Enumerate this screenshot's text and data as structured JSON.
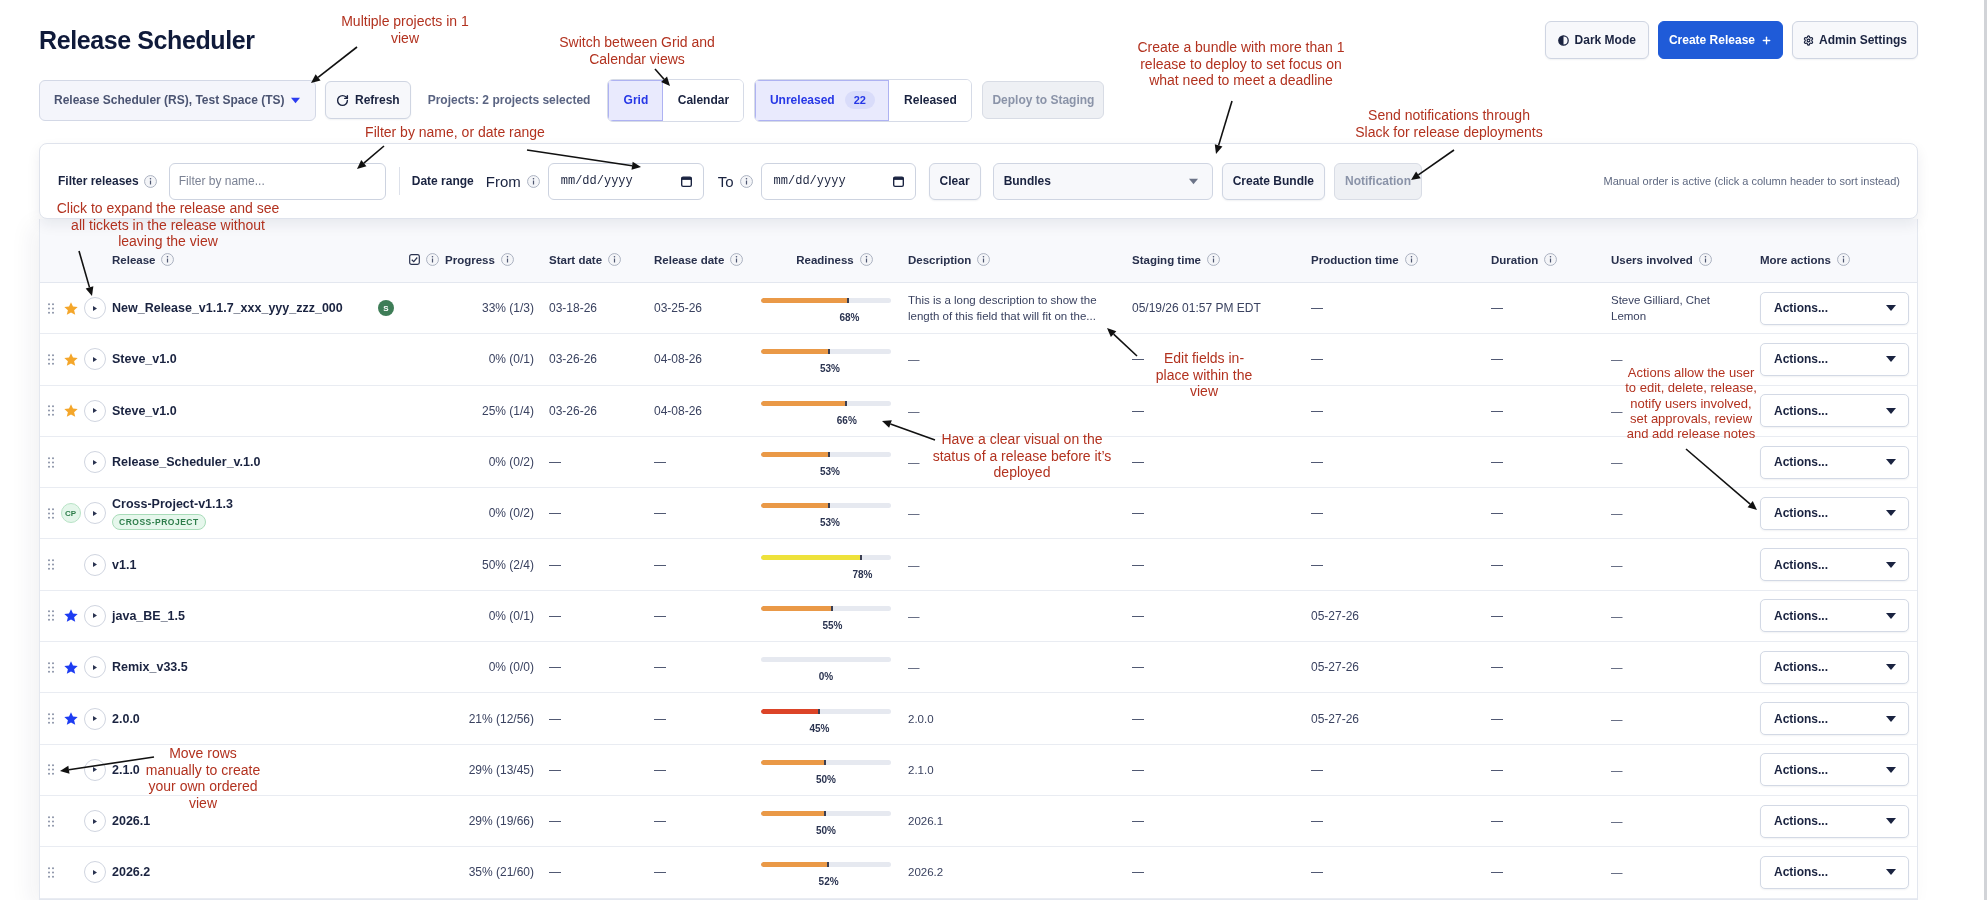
{
  "header": {
    "title": "Release Scheduler",
    "buttons": [
      {
        "kind": "theme",
        "label": "Dark Mode"
      },
      {
        "kind": "create",
        "label": "Create Release"
      },
      {
        "kind": "settings",
        "label": "Admin Settings"
      }
    ]
  },
  "toolbar": {
    "project_select": {
      "value": "Release Scheduler (RS), Test Space (TS)"
    },
    "refresh": {
      "label": "Refresh"
    },
    "projects_summary": "Projects: 2 projects selected",
    "view_modes": [
      {
        "label": "Grid",
        "selected": true
      },
      {
        "label": "Calendar",
        "selected": false
      }
    ],
    "status_tabs": [
      {
        "label": "Unreleased",
        "count": "22",
        "selected": true
      },
      {
        "label": "Released",
        "selected": false
      }
    ],
    "deploy": {
      "label": "Deploy to Staging",
      "disabled": true
    }
  },
  "filters": {
    "name_filter": {
      "label": "Filter releases",
      "placeholder": "Filter by name..."
    },
    "date_range": {
      "label": "Date range",
      "from": {
        "label": "From",
        "placeholder": "mm/dd/yyyy"
      },
      "to": {
        "label": "To",
        "placeholder": "mm/dd/yyyy"
      }
    },
    "clear": {
      "label": "Clear",
      "disabled": false
    },
    "bundle_select": {
      "value": "Bundles"
    },
    "create_bundle": {
      "label": "Create Bundle",
      "disabled": false
    },
    "notification": {
      "label": "Notification",
      "disabled": true
    },
    "sort_note": "Manual order is active (click a column header to sort instead)"
  },
  "table": {
    "columns": [
      {
        "label": "Release"
      },
      {
        "label": "Progress",
        "toggle": {
          "checked": true
        }
      },
      {
        "label": "Start date"
      },
      {
        "label": "Release date"
      },
      {
        "label": "Readiness"
      },
      {
        "label": "Description"
      },
      {
        "label": "Staging time"
      },
      {
        "label": "Production time"
      },
      {
        "label": "Duration"
      },
      {
        "label": "Users involved"
      },
      {
        "label": "More actions"
      }
    ],
    "rows": [
      {
        "marker": {
          "kind": "star",
          "color": "#f4a62a"
        },
        "name": "New_Release_v1.1.7_xxx_yyy_zzz_000",
        "avatar": "S",
        "progress": "33% (1/3)",
        "start_date": "03-18-26",
        "release_date": "03-25-26",
        "readiness": {
          "level": 0.68,
          "label": "68%"
        },
        "description": "This is a long description to show the length of this field that will fit on the...",
        "staging_time": "05/19/26 01:57 PM EDT",
        "production_time": "—",
        "duration": "—",
        "users": "Steve Gilliard, Chet Lemon",
        "action": "Actions..."
      },
      {
        "marker": {
          "kind": "star",
          "color": "#f4a62a"
        },
        "name": "Steve_v1.0",
        "progress": "0% (0/1)",
        "start_date": "03-26-26",
        "release_date": "04-08-26",
        "readiness": {
          "level": 0.53,
          "label": "53%"
        },
        "description": "—",
        "staging_time": "—",
        "production_time": "—",
        "duration": "—",
        "users": "—",
        "action": "Actions..."
      },
      {
        "marker": {
          "kind": "star",
          "color": "#f4a62a"
        },
        "name": "Steve_v1.0",
        "progress": "25% (1/4)",
        "start_date": "03-26-26",
        "release_date": "04-08-26",
        "readiness": {
          "level": 0.66,
          "label": "66%"
        },
        "description": "—",
        "staging_time": "—",
        "production_time": "—",
        "duration": "—",
        "users": "—",
        "action": "Actions..."
      },
      {
        "name": "Release_Scheduler_v.1.0",
        "progress": "0% (0/2)",
        "start_date": "—",
        "release_date": "—",
        "readiness": {
          "level": 0.53,
          "label": "53%"
        },
        "description": "—",
        "staging_time": "—",
        "production_time": "—",
        "duration": "—",
        "users": "—",
        "action": "Actions..."
      },
      {
        "marker": {
          "kind": "badge",
          "label": "CP"
        },
        "name": "Cross-Project-v1.1.3",
        "tag": "CROSS-PROJECT",
        "progress": "0% (0/2)",
        "start_date": "—",
        "release_date": "—",
        "readiness": {
          "level": 0.53,
          "label": "53%"
        },
        "description": "—",
        "staging_time": "—",
        "production_time": "—",
        "duration": "—",
        "users": "—",
        "action": "Actions..."
      },
      {
        "name": "v1.1",
        "progress": "50% (2/4)",
        "start_date": "—",
        "release_date": "—",
        "readiness": {
          "level": 0.78,
          "label": "78%"
        },
        "description": "—",
        "staging_time": "—",
        "production_time": "—",
        "duration": "—",
        "users": "—",
        "action": "Actions..."
      },
      {
        "marker": {
          "kind": "star",
          "color": "#1d3cf2"
        },
        "name": "java_BE_1.5",
        "progress": "0% (0/1)",
        "start_date": "—",
        "release_date": "—",
        "readiness": {
          "level": 0.55,
          "label": "55%"
        },
        "description": "—",
        "staging_time": "—",
        "production_time": "05-27-26",
        "duration": "—",
        "users": "—",
        "action": "Actions..."
      },
      {
        "marker": {
          "kind": "star",
          "color": "#1d3cf2"
        },
        "name": "Remix_v33.5",
        "progress": "0% (0/0)",
        "start_date": "—",
        "release_date": "—",
        "readiness": {
          "level": 0,
          "label": "0%"
        },
        "description": "—",
        "staging_time": "—",
        "production_time": "05-27-26",
        "duration": "—",
        "users": "—",
        "action": "Actions..."
      },
      {
        "marker": {
          "kind": "star",
          "color": "#1d3cf2"
        },
        "name": "2.0.0",
        "progress": "21% (12/56)",
        "start_date": "—",
        "release_date": "—",
        "readiness": {
          "level": 0.45,
          "label": "45%"
        },
        "description": "2.0.0",
        "staging_time": "—",
        "production_time": "05-27-26",
        "duration": "—",
        "users": "—",
        "action": "Actions..."
      },
      {
        "name": "2.1.0",
        "progress": "29% (13/45)",
        "start_date": "—",
        "release_date": "—",
        "readiness": {
          "level": 0.5,
          "label": "50%"
        },
        "description": "2.1.0",
        "staging_time": "—",
        "production_time": "—",
        "duration": "—",
        "users": "—",
        "action": "Actions..."
      },
      {
        "name": "2026.1",
        "progress": "29% (19/66)",
        "start_date": "—",
        "release_date": "—",
        "readiness": {
          "level": 0.5,
          "label": "50%"
        },
        "description": "2026.1",
        "staging_time": "—",
        "production_time": "—",
        "duration": "—",
        "users": "—",
        "action": "Actions..."
      },
      {
        "name": "2026.2",
        "progress": "35% (21/60)",
        "start_date": "—",
        "release_date": "—",
        "readiness": {
          "level": 0.52,
          "label": "52%"
        },
        "description": "2026.2",
        "staging_time": "—",
        "production_time": "—",
        "duration": "—",
        "users": "—",
        "action": "Actions..."
      }
    ]
  },
  "annotations": [
    {
      "lines": [
        "Multiple projects in 1",
        "view"
      ]
    },
    {
      "lines": [
        "Switch between Grid and",
        "Calendar views"
      ]
    },
    {
      "lines": [
        "Create a bundle with more than 1",
        "release to deploy to set focus on",
        "what need to meet a deadline"
      ]
    },
    {
      "lines": [
        "Filter by name, or date range"
      ]
    },
    {
      "lines": [
        "Send notifications through",
        "Slack for release deployments"
      ]
    },
    {
      "lines": [
        "Click to expand the release and see",
        "all tickets in the release without",
        "leaving the view"
      ]
    },
    {
      "lines": [
        "Edit fields in-",
        "place within the",
        "view"
      ]
    },
    {
      "lines": [
        "Actions allow the user",
        "to edit, delete, release,",
        "notify users involved,",
        "set approvals, review",
        "and add release notes"
      ]
    },
    {
      "lines": [
        "Have a clear visual on the",
        "status of a release before it’s",
        "deployed"
      ]
    },
    {
      "lines": [
        "Move rows",
        "manually to create",
        "your own ordered",
        "view"
      ]
    }
  ]
}
